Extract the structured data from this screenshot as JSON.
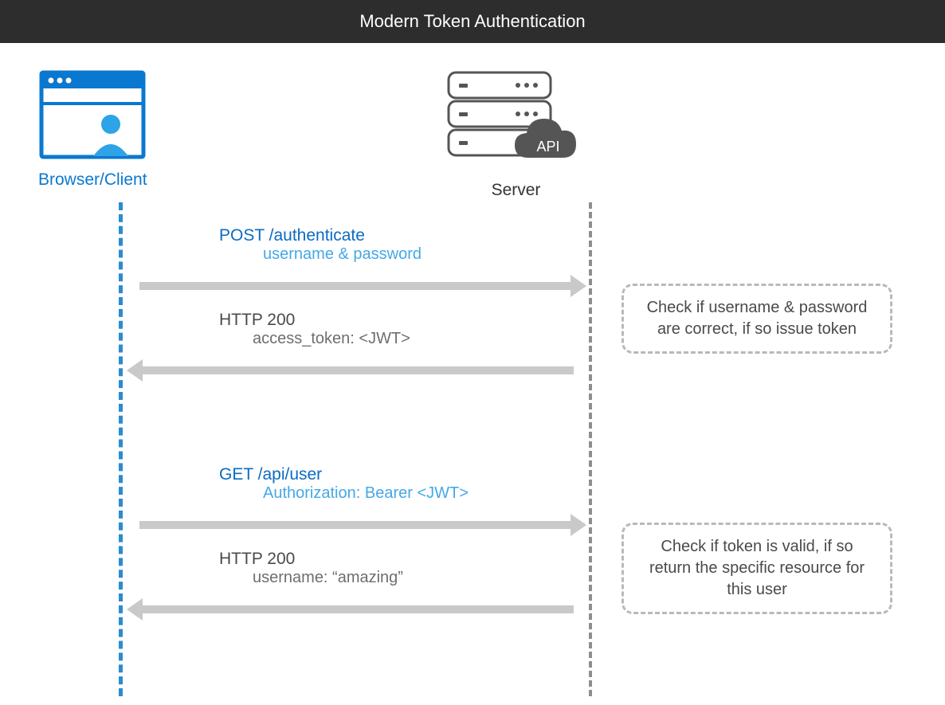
{
  "header": {
    "title": "Modern Token Authentication"
  },
  "actors": {
    "client": {
      "label": "Browser/Client"
    },
    "server": {
      "label": "Server",
      "api_badge": "API"
    }
  },
  "messages": {
    "req1": {
      "title": "POST /authenticate",
      "sub": "username & password"
    },
    "resp1": {
      "title": "HTTP 200",
      "sub": "access_token: <JWT>"
    },
    "req2": {
      "title": "GET /api/user",
      "sub": "Authorization: Bearer <JWT>"
    },
    "resp2": {
      "title": "HTTP 200",
      "sub": "username: “amazing”"
    }
  },
  "notes": {
    "n1": "Check if username & password are correct, if so issue token",
    "n2": "Check if token is valid, if so return the specific resource for this user"
  }
}
